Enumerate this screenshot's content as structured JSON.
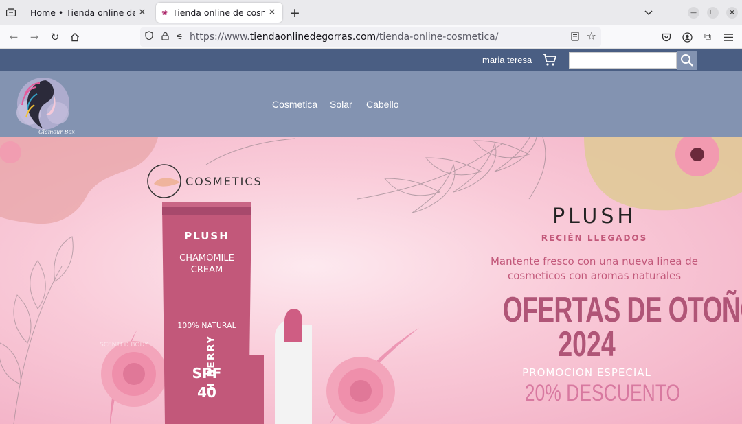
{
  "browser": {
    "tabs": [
      {
        "title": "Home • Tienda online de cosmetica",
        "active": false
      },
      {
        "title": "Tienda online de cosmetica",
        "active": true
      }
    ],
    "url_prefix": "https://www.",
    "url_domain": "tiendaonlinedegorras.com",
    "url_path": "/tienda-online-cosmetica/"
  },
  "site": {
    "user_name": "maria teresa",
    "search": {
      "value": "",
      "placeholder": ""
    },
    "logo_text": "Glamour Box",
    "menu": [
      "Cosmetica",
      "Solar",
      "Cabello"
    ]
  },
  "hero": {
    "brand": "COSMETICS",
    "product": {
      "line": "PLUSH",
      "name1": "CHAMOMILE",
      "name2": "CREAM",
      "natural": "100% NATURAL",
      "spf1": "SPF",
      "spf2": "40",
      "lipstick_label": "H BERRY",
      "faded_label": "SCENTED BODY"
    },
    "headline": "PLUSH",
    "subheadline": "RECIÉN LLEGADOS",
    "tagline1": "Mantente fresco con una nueva linea de",
    "tagline2": "cosmeticos con aromas naturales",
    "offer1": "OFERTAS DE OTOÑO",
    "offer2": "2024",
    "promo": "PROMOCION ESPECIAL",
    "discount": "20% DESCUENTO"
  },
  "colors": {
    "top_bar": "#4a5e83",
    "nav_bar": "#8393b1",
    "accent": "#c2587a",
    "heading": "#a7496c"
  }
}
